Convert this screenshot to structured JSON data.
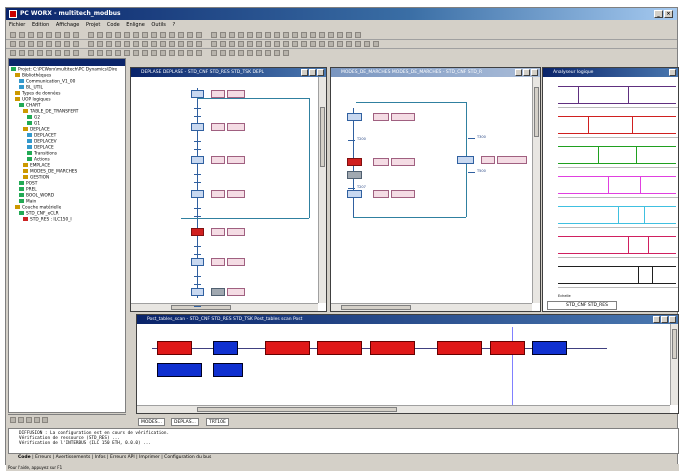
{
  "window": {
    "title": "PC WORX - multitech_modbus"
  },
  "menu": [
    "Fichier",
    "Edition",
    "Affichage",
    "Projet",
    "Code",
    "Enligne",
    "Outils",
    "?"
  ],
  "tree": {
    "items": [
      {
        "label": "Projet: C:\\PCWorx\\multitech\\PC Dynamics\\Dire",
        "color": "#2a5"
      },
      {
        "label": "Bibliothèques",
        "color": "#c90"
      },
      {
        "label": "Communication_V1_00",
        "color": "#39c"
      },
      {
        "label": "BL_UTIL",
        "color": "#39c"
      },
      {
        "label": "Types de données",
        "color": "#c90"
      },
      {
        "label": "UOP logiques",
        "color": "#c90"
      },
      {
        "label": "CHART",
        "color": "#2a5"
      },
      {
        "label": "TABLE_DE_TRANSFERT",
        "color": "#c90"
      },
      {
        "label": "G2",
        "color": "#2a5"
      },
      {
        "label": "G1",
        "color": "#2a5"
      },
      {
        "label": "DEPLACE",
        "color": "#c90"
      },
      {
        "label": "DEPLACET",
        "color": "#39c"
      },
      {
        "label": "DEPLACEV",
        "color": "#39c"
      },
      {
        "label": "DEPLACE",
        "color": "#39c"
      },
      {
        "label": "Transitions",
        "color": "#2a5"
      },
      {
        "label": "Actions",
        "color": "#2a5"
      },
      {
        "label": "EMPLACE",
        "color": "#c90"
      },
      {
        "label": "MODES_DE_MARCHES",
        "color": "#c90"
      },
      {
        "label": "GESTION",
        "color": "#c90"
      },
      {
        "label": "POST",
        "color": "#2a5"
      },
      {
        "label": "PREL",
        "color": "#2a5"
      },
      {
        "label": "BOOL_WORD",
        "color": "#2a5"
      },
      {
        "label": "Main",
        "color": "#2a5"
      },
      {
        "label": "Couche matérielle",
        "color": "#c90"
      },
      {
        "label": "STD_CNF_eCLR",
        "color": "#2a5"
      },
      {
        "label": "STD_RES : ILC150_I",
        "color": "#c22"
      }
    ]
  },
  "win1": {
    "title": "DEPLASE DEPLASE - STD_CNF STD_RES STD_TSK DEPL"
  },
  "win2": {
    "title": "MODES_DE_MARCHES MODES_DE_MARCHES - STD_CNF STD_R"
  },
  "win3": {
    "title": "Analyseur logique",
    "tab": "STD_CNF STD_RES",
    "xlabel": "Echelle"
  },
  "win4": {
    "title": "Post_tables_scan - STD_CNF STD_RES STD_TSK Post_tables scan Post"
  },
  "sfc": {
    "t1": "T200",
    "t2": "T100",
    "t3": "T300",
    "t4": "T500",
    "t5": "T207"
  },
  "mdi_tabs": [
    "MODES...",
    "DEPLAS...",
    "TRT10E"
  ],
  "output": {
    "lines": [
      "DIFFUSION : La configuration est en cours de vérification.",
      "Vérification de ressource (STD_RES) ...",
      "Vérification de l'INTERBUS (ILC 150 ETH, 0.0.0) ..."
    ]
  },
  "output_tabs": [
    "Code",
    "Erreurs",
    "Avertissements",
    "Infos",
    "Erreurs API",
    "Imprimer",
    "Configuration du bus"
  ],
  "status": {
    "left": "Pour l'aide, appuyez sur F1"
  }
}
